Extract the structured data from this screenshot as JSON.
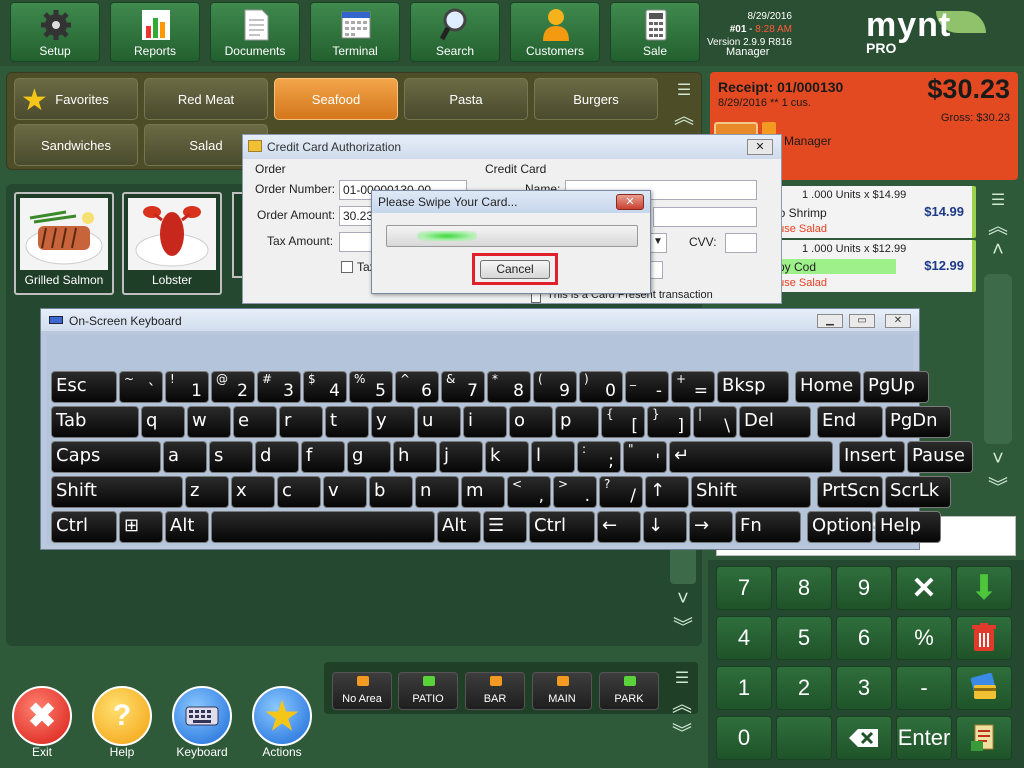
{
  "toolbar": {
    "buttons": [
      {
        "label": "Setup",
        "icon": "gear-icon"
      },
      {
        "label": "Reports",
        "icon": "chart-icon"
      },
      {
        "label": "Documents",
        "icon": "document-icon"
      },
      {
        "label": "Terminal",
        "icon": "calendar-icon"
      },
      {
        "label": "Search",
        "icon": "magnifier-icon"
      },
      {
        "label": "Customers",
        "icon": "person-icon"
      },
      {
        "label": "Sale",
        "icon": "calculator-icon"
      }
    ]
  },
  "header": {
    "date": "8/29/2016",
    "terminal": "#01 - 8:28 AM",
    "terminal_num": "#01",
    "time": "8:28 AM",
    "version": "Version 2.9.9 R816",
    "user": "Manager",
    "logo": "mynt",
    "logo_sub": "PRO"
  },
  "categories": [
    "Favorites",
    "Red Meat",
    "Seafood",
    "Pasta",
    "Burgers",
    "Sandwiches",
    "Salad"
  ],
  "active_category": "Seafood",
  "items": [
    {
      "label": "Grilled Salmon"
    },
    {
      "label": "Lobster"
    }
  ],
  "receipt": {
    "title": "Receipt: 01/000130",
    "sub": "8/29/2016  **  1 cus.",
    "total": "$30.23",
    "gross": "Gross: $30.23",
    "server": "Manager"
  },
  "order_lines": [
    {
      "qty": "1 .000 Units",
      "unit": "x $14.99",
      "name": "bo Shrimp",
      "price": "$14.99",
      "mod": "ouse Salad"
    },
    {
      "qty": "1 .000 Units",
      "unit": "x $12.99",
      "name": "spy Cod",
      "price": "$12.99",
      "mod": "ouse Salad"
    }
  ],
  "keypad": {
    "keys": [
      "7",
      "8",
      "9",
      "4",
      "5",
      "6",
      "%",
      "1",
      "2",
      "3",
      "-",
      "0",
      "Enter"
    ]
  },
  "areas": [
    "No Area",
    "PATIO",
    "BAR",
    "MAIN",
    "PARK"
  ],
  "bottom_buttons": [
    "Exit",
    "Help",
    "Keyboard",
    "Actions"
  ],
  "cc_dialog": {
    "title": "Credit Card Authorization",
    "order_section": "Order",
    "card_section": "Credit Card",
    "order_number_label": "Order Number:",
    "order_number_value": "01-00000130-00",
    "order_amount_label": "Order Amount:",
    "order_amount_value": "30.23",
    "tax_amount_label": "Tax Amount:",
    "tax_checkbox": "Tax",
    "name_label": "Name:",
    "cvv_label": "CVV:",
    "card_present": "This is a Card Present transaction"
  },
  "swipe_dialog": {
    "title": "Please Swipe Your Card...",
    "cancel": "Cancel",
    "progress": 0.25
  },
  "osk": {
    "title": "On-Screen Keyboard",
    "rows": [
      [
        "Esc",
        "~ `",
        "! 1",
        "@ 2",
        "# 3",
        "$ 4",
        "% 5",
        "^ 6",
        "& 7",
        "* 8",
        "( 9",
        ") 0",
        "_ -",
        "+ =",
        "Bksp",
        "Home",
        "PgUp"
      ],
      [
        "Tab",
        "q",
        "w",
        "e",
        "r",
        "t",
        "y",
        "u",
        "i",
        "o",
        "p",
        "{ [",
        "} ]",
        "| \\",
        "Del",
        "End",
        "PgDn"
      ],
      [
        "Caps",
        "a",
        "s",
        "d",
        "f",
        "g",
        "h",
        "j",
        "k",
        "l",
        ": ;",
        "\" '",
        "↵",
        "Insert",
        "Pause"
      ],
      [
        "Shift",
        "z",
        "x",
        "c",
        "v",
        "b",
        "n",
        "m",
        "< ,",
        "> .",
        "? /",
        "↑",
        "Shift",
        "PrtScn",
        "ScrLk"
      ],
      [
        "Ctrl",
        "⊞",
        "Alt",
        "",
        "Alt",
        "☰",
        "Ctrl",
        "←",
        "↓",
        "→",
        "Fn",
        "Options",
        "Help"
      ]
    ]
  },
  "colors": {
    "background": "#2e5a3a",
    "accent_orange": "#e8821f",
    "receipt_red": "#e44a22",
    "highlight_red": "#e0202a"
  }
}
